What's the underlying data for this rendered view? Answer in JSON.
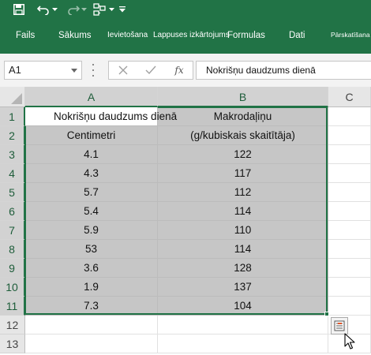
{
  "ribbon": {
    "tabs": [
      {
        "label": "Fails"
      },
      {
        "label": "Sākums"
      },
      {
        "label": "Ievietošana"
      },
      {
        "label": "Lappuses izkārtojums"
      },
      {
        "label": "Formulas"
      },
      {
        "label": "Dati"
      },
      {
        "label": "Pārskatīšana"
      }
    ]
  },
  "formula_bar": {
    "name_box": "A1",
    "fx_label": "fx",
    "content": "Nokrišņu daudzums dienā"
  },
  "grid": {
    "columns": [
      "A",
      "B",
      "C"
    ],
    "rows": [
      "1",
      "2",
      "3",
      "4",
      "5",
      "6",
      "7",
      "8",
      "9",
      "10",
      "11",
      "12",
      "13"
    ],
    "cells": [
      [
        "Nokrišņu daudzums dienā",
        "Makrodaļiņu"
      ],
      [
        "Centimetri",
        "(g/kubiskais skaitītāja)"
      ],
      [
        "4.1",
        "122"
      ],
      [
        "4.3",
        "117"
      ],
      [
        "5.7",
        "112"
      ],
      [
        "5.4",
        "114"
      ],
      [
        "5.9",
        "110"
      ],
      [
        "53",
        "114"
      ],
      [
        "3.6",
        "128"
      ],
      [
        "1.9",
        "137"
      ],
      [
        "7.3",
        "104"
      ]
    ]
  },
  "colors": {
    "accent": "#217346",
    "selection_fill": "#c6c6c6",
    "header_fill": "#e6e6e6"
  },
  "icons": {
    "save": "save-icon",
    "undo": "undo-icon",
    "redo": "redo-icon",
    "layout": "layout-icon",
    "customize": "customize-qat-icon",
    "cancel": "cancel-x-icon",
    "enter": "checkmark-icon",
    "quick_analysis": "quick-analysis-icon"
  }
}
